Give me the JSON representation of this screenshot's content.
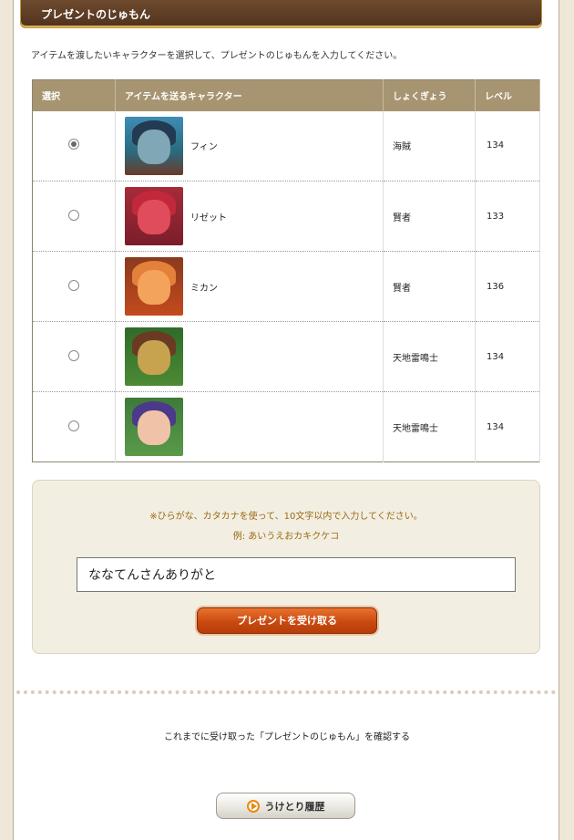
{
  "header": {
    "title": "プレゼントのじゅもん"
  },
  "intro_text": "アイテムを渡したいキャラクターを選択して、プレゼントのじゅもんを入力してください。",
  "table": {
    "columns": [
      "選択",
      "アイテムを送るキャラクター",
      "しょくぎょう",
      "レベル"
    ],
    "rows": [
      {
        "selected": true,
        "name": "フィン",
        "job": "海賊",
        "level": "134",
        "avatar": "avatar-blue-hooded"
      },
      {
        "selected": false,
        "name": "リゼット",
        "job": "賢者",
        "level": "133",
        "avatar": "avatar-red-pukuripo"
      },
      {
        "selected": false,
        "name": "ミカン",
        "job": "賢者",
        "level": "136",
        "avatar": "avatar-orange-cat"
      },
      {
        "selected": false,
        "name": "",
        "job": "天地雷鳴士",
        "level": "134",
        "avatar": "avatar-goggles-dwarf"
      },
      {
        "selected": false,
        "name": "",
        "job": "天地雷鳴士",
        "level": "134",
        "avatar": "avatar-purple-elf"
      }
    ]
  },
  "form": {
    "note": "※ひらがな、カタカナを使って、10文字以内で入力してください。",
    "example": "例: あいうえおカキクケコ",
    "input_value": "ななてんさんありがと",
    "submit_label": "プレゼントを受け取る"
  },
  "history": {
    "note": "これまでに受け取った「プレゼントのじゅもん」を確認する",
    "button_label": "うけとり履歴"
  },
  "colors": {
    "header_brown": "#5c3b22",
    "table_header": "#a79471",
    "accent_orange": "#c94a10",
    "note_text": "#9a6a14"
  }
}
